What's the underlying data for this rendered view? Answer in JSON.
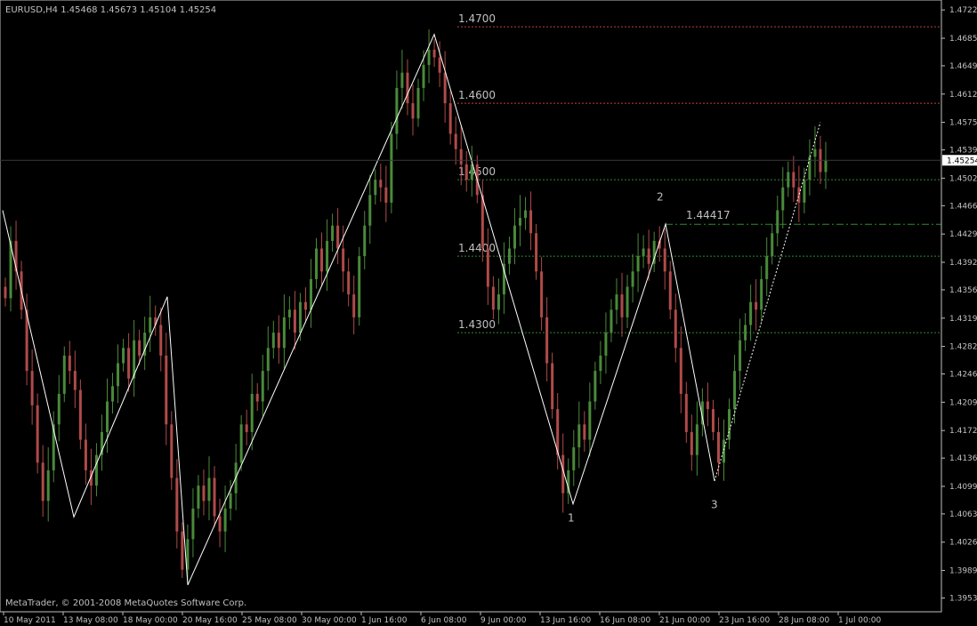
{
  "window": {
    "header": "EURUSD,H4  1.45468 1.45673 1.45104 1.45254",
    "copyright": "MetaTrader, © 2001-2008 MetaQuotes Software Corp."
  },
  "colors": {
    "background": "#000000",
    "frame": "#c0c0c0",
    "bull_candle": "#4a8a3a",
    "bear_candle": "#b04a4a",
    "zigzag": "#ffffff",
    "red_level": "#c04040",
    "green_level": "#2e8a2e",
    "label": "#c0c0c0"
  },
  "chart_data": {
    "type": "candlestick",
    "symbol": "EURUSD",
    "timeframe": "H4",
    "last_ohlc": {
      "open": 1.45468,
      "high": 1.45673,
      "low": 1.45104,
      "close": 1.45254
    },
    "current_price": "1.45254",
    "ylim": [
      1.3935,
      1.4735
    ],
    "y_ticks": [
      "1.47220",
      "1.46850",
      "1.46490",
      "1.46120",
      "1.45750",
      "1.45390",
      "1.45020",
      "1.44660",
      "1.44290",
      "1.43920",
      "1.43560",
      "1.43190",
      "1.42820",
      "1.42460",
      "1.42090",
      "1.41720",
      "1.41360",
      "1.40990",
      "1.40630",
      "1.40260",
      "1.39890",
      "1.39530"
    ],
    "x_ticks": [
      "10 May 2011",
      "13 May 08:00",
      "18 May 00:00",
      "20 May 16:00",
      "25 May 08:00",
      "30 May 00:00",
      "1 Jun 16:00",
      "6 Jun 08:00",
      "9 Jun 00:00",
      "13 Jun 16:00",
      "16 Jun 08:00",
      "21 Jun 00:00",
      "23 Jun 16:00",
      "28 Jun 08:00",
      "1 Jul 00:00"
    ],
    "levels": [
      {
        "label": "1.4700",
        "price": 1.47,
        "color": "red"
      },
      {
        "label": "1.4600",
        "price": 1.46,
        "color": "red"
      },
      {
        "label": "1.4500",
        "price": 1.45,
        "color": "green"
      },
      {
        "label": "1.4400",
        "price": 1.44,
        "color": "green"
      },
      {
        "label": "1.4300",
        "price": 1.43,
        "color": "green"
      }
    ],
    "resistance": {
      "label": "1.44417",
      "price": 1.44417
    },
    "wave_labels": [
      {
        "label": "1",
        "price": 1.4076
      },
      {
        "label": "2",
        "price": 1.4452
      },
      {
        "label": "3",
        "price": 1.4094
      }
    ],
    "zigzag": [
      1.446,
      1.4059,
      1.4347,
      1.397,
      1.469,
      1.4076,
      1.4442,
      1.4106
    ],
    "projection": [
      1.4106,
      1.4575
    ],
    "candle_closes": [
      1.4345,
      1.442,
      1.438,
      1.433,
      1.425,
      1.4205,
      1.413,
      1.408,
      1.412,
      1.418,
      1.422,
      1.427,
      1.425,
      1.4225,
      1.416,
      1.412,
      1.41,
      1.414,
      1.417,
      1.421,
      1.423,
      1.426,
      1.428,
      1.424,
      1.429,
      1.427,
      1.43,
      1.432,
      1.431,
      1.427,
      1.418,
      1.411,
      1.404,
      1.399,
      1.403,
      1.407,
      1.41,
      1.408,
      1.411,
      1.406,
      1.404,
      1.407,
      1.409,
      1.413,
      1.418,
      1.417,
      1.422,
      1.421,
      1.425,
      1.428,
      1.43,
      1.428,
      1.432,
      1.433,
      1.43,
      1.434,
      1.433,
      1.437,
      1.441,
      1.438,
      1.442,
      1.444,
      1.441,
      1.438,
      1.435,
      1.432,
      1.44,
      1.444,
      1.448,
      1.45,
      1.449,
      1.447,
      1.456,
      1.462,
      1.464,
      1.46,
      1.458,
      1.462,
      1.465,
      1.467,
      1.466,
      1.464,
      1.46,
      1.456,
      1.454,
      1.452,
      1.45,
      1.452,
      1.448,
      1.441,
      1.436,
      1.433,
      1.435,
      1.439,
      1.441,
      1.444,
      1.445,
      1.446,
      1.443,
      1.438,
      1.432,
      1.426,
      1.42,
      1.414,
      1.409,
      1.412,
      1.415,
      1.418,
      1.416,
      1.421,
      1.425,
      1.427,
      1.43,
      1.433,
      1.435,
      1.432,
      1.436,
      1.438,
      1.44,
      1.441,
      1.439,
      1.442,
      1.441,
      1.438,
      1.433,
      1.428,
      1.422,
      1.417,
      1.414,
      1.418,
      1.421,
      1.42,
      1.417,
      1.413,
      1.416,
      1.42,
      1.425,
      1.429,
      1.431,
      1.434,
      1.433,
      1.437,
      1.44,
      1.443,
      1.446,
      1.449,
      1.451,
      1.449,
      1.447,
      1.45,
      1.453,
      1.454,
      1.451,
      1.4525
    ]
  }
}
